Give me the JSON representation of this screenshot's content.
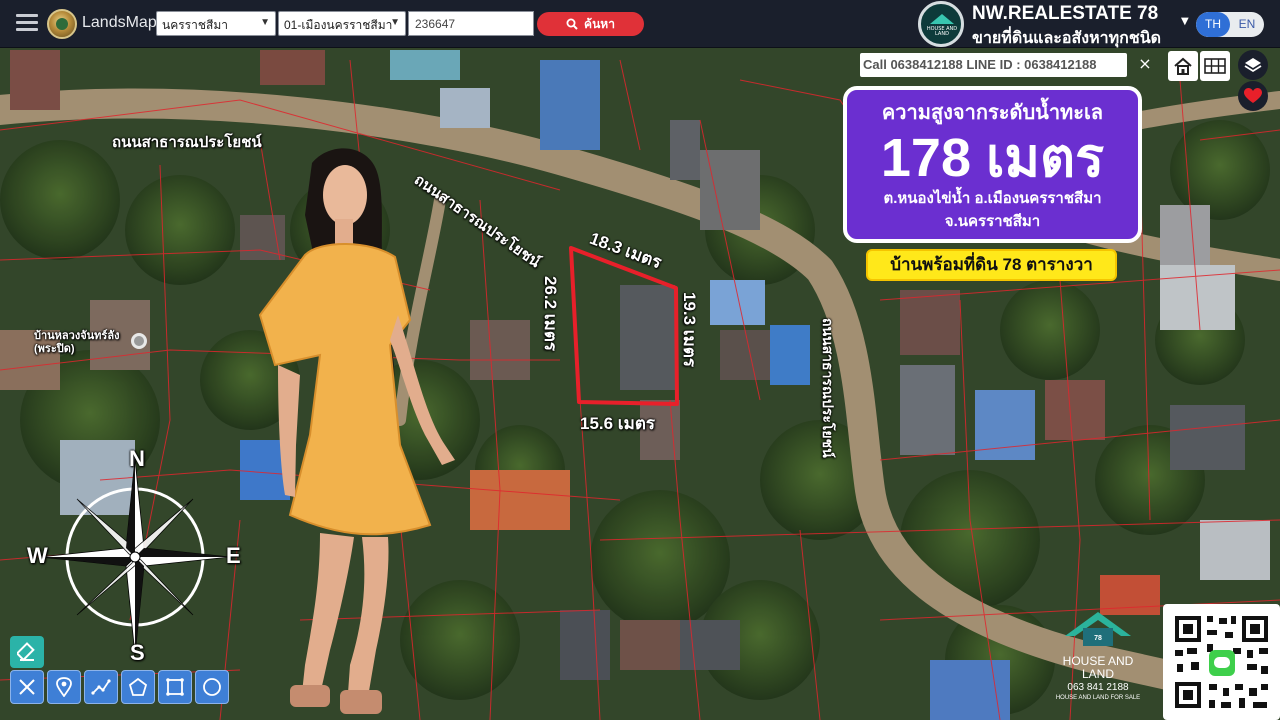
{
  "app": {
    "brand": "LandsMaps",
    "province_select": "นครราชสีมา",
    "amphoe_select": "01-เมืองนครราชสีมา",
    "search_value": "236647",
    "search_button": "ค้นหา",
    "lang_th": "TH",
    "lang_en": "EN"
  },
  "agency": {
    "name": "NW.REALESTATE 78",
    "tagline": "ขายที่ดินและอสังหาทุกชนิด",
    "logo_text": "HOUSE AND LAND 063 841 2188"
  },
  "contact": {
    "call_text": "Call 0638412188 LINE ID : 0638412188",
    "close": "×"
  },
  "elevation": {
    "title": "ความสูงจากระดับน้ำทะเล",
    "value": "178 เมตร",
    "location_line1": "ต.หนองไข่น้ำ อ.เมืองนครราชสีมา",
    "location_line2": "จ.นครราชสีมา"
  },
  "listing_badge": "บ้านพร้อมที่ดิน 78 ตารางวา",
  "map": {
    "roads": [
      "ถนนสาธารณประโยชน์",
      "ถนนสาธารณประโยชน์",
      "ถนนสาธารณประโยชน์"
    ],
    "place": "บ้านหลวงจันทร์ลัง (พระปิด)",
    "plot_sides": {
      "top": "18.3 เมตร",
      "left": "26.2 เมตร",
      "right": "19.3 เมตร",
      "bottom": "15.6 เมตร"
    }
  },
  "compass": {
    "n": "N",
    "s": "S",
    "e": "E",
    "w": "W"
  },
  "brand_bottom": {
    "line1": "HOUSE AND",
    "line2": "LAND",
    "phone": "063 841 2188",
    "small": "HOUSE AND LAND FOR SALE"
  },
  "colors": {
    "topbar": "#1a1f2c",
    "search_button": "#e03138",
    "elevation_box": "#6b2fd0",
    "listing_badge": "#ffe81a",
    "plot_outline": "#e8202a",
    "draw_tools": "#3e7fd6"
  }
}
